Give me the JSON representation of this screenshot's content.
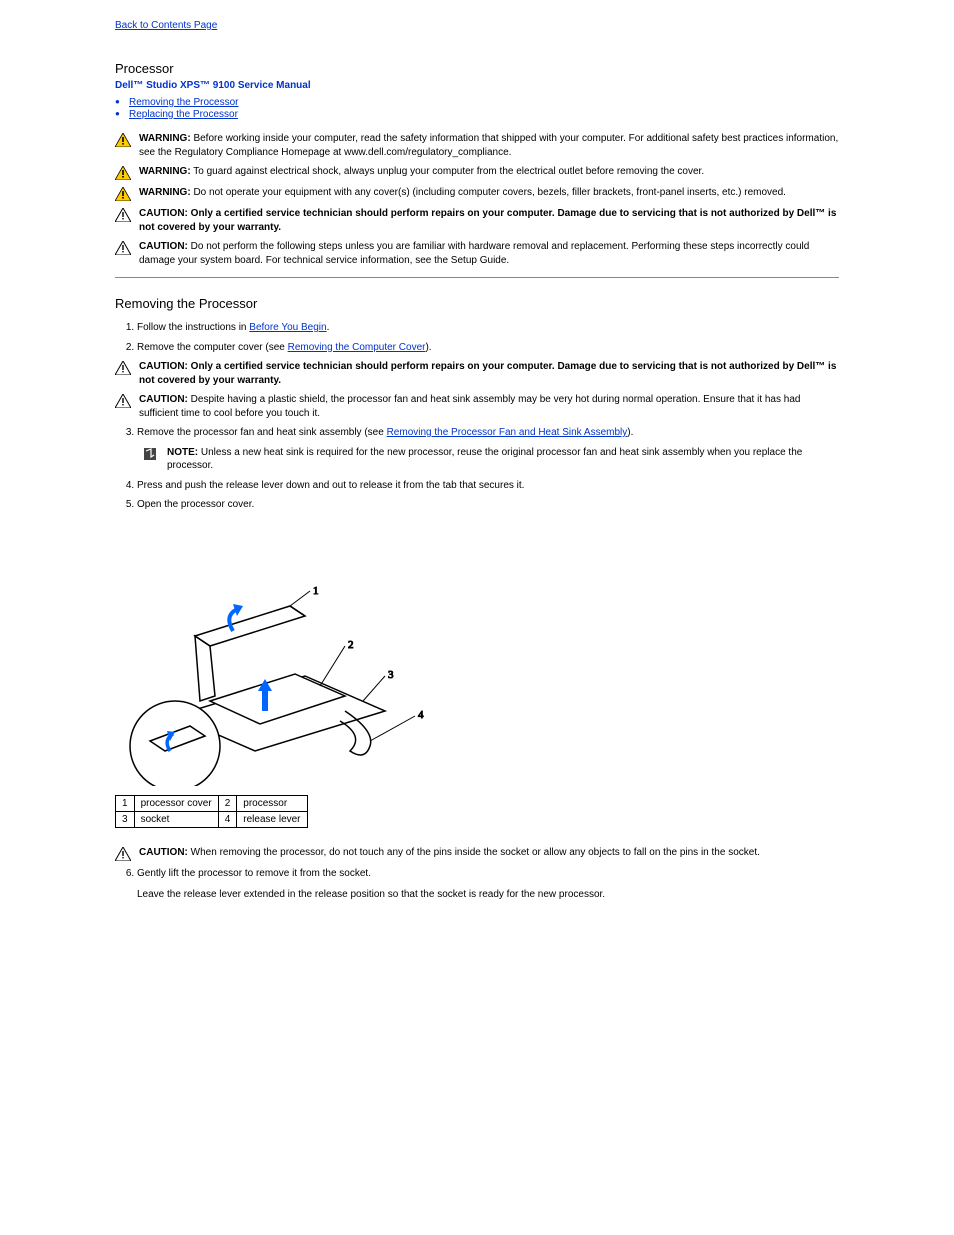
{
  "nav": {
    "back": "Back to Contents Page"
  },
  "header": {
    "title": "Processor",
    "subtitle": "Dell™ Studio XPS™ 9100 Service Manual"
  },
  "toc": [
    {
      "label": "Removing the Processor"
    },
    {
      "label": "Replacing the Processor"
    }
  ],
  "warnings": {
    "w1_label": "WARNING:",
    "w1_text": "Before working inside your computer, read the safety information that shipped with your computer. For additional safety best practices information, see the Regulatory Compliance Homepage at www.dell.com/regulatory_compliance.",
    "w2_label": "WARNING:",
    "w2_text": "To guard against electrical shock, always unplug your computer from the electrical outlet before removing the cover.",
    "w3_label": "WARNING:",
    "w3_text": "Do not operate your equipment with any cover(s) (including computer covers, bezels, filler brackets, front-panel inserts, etc.) removed.",
    "c1_label": "CAUTION:",
    "c1_text": "Only a certified service technician should perform repairs on your computer. Damage due to servicing that is not authorized by Dell™ is not covered by your warranty.",
    "c2_label": "CAUTION:",
    "c2_text": "Do not perform the following steps unless you are familiar with hardware removal and replacement. Performing these steps incorrectly could damage your system board. For technical service information, see the Setup Guide."
  },
  "section1": {
    "title": "Removing the Processor",
    "step1_a": "Follow the instructions in ",
    "step1_link": "Before You Begin",
    "step1_b": ".",
    "step2_a": "Remove the computer cover (see ",
    "step2_link": "Removing the Computer Cover",
    "step2_b": ").",
    "c3_label": "CAUTION:",
    "c3_text": "Only a certified service technician should perform repairs on your computer. Damage due to servicing that is not authorized by Dell™ is not covered by your warranty.",
    "c4_label": "CAUTION:",
    "c4_text": "Despite having a plastic shield, the processor fan and heat sink assembly may be very hot during normal operation. Ensure that it has had sufficient time to cool before you touch it.",
    "step3_a": "Remove the processor fan and heat sink assembly (see ",
    "step3_link": "Removing the Processor Fan and Heat Sink Assembly",
    "step3_b": ").",
    "note_label": "NOTE:",
    "note_text": "Unless a new heat sink is required for the new processor, reuse the original processor fan and heat sink assembly when you replace the processor.",
    "step4": "Press and push the release lever down and out to release it from the tab that secures it.",
    "step5": "Open the processor cover."
  },
  "legend": {
    "r1c1": "1",
    "r1c2": "processor cover",
    "r1c3": "2",
    "r1c4": "processor",
    "r2c1": "3",
    "r2c2": "socket",
    "r2c3": "4",
    "r2c4": "release lever"
  },
  "caution_bottom": {
    "label": "CAUTION:",
    "text": "When removing the processor, do not touch any of the pins inside the socket or allow any objects to fall on the pins in the socket."
  },
  "step6": "Gently lift the processor to remove it from the socket.",
  "step6_after": "Leave the release lever extended in the release position so that the socket is ready for the new processor."
}
